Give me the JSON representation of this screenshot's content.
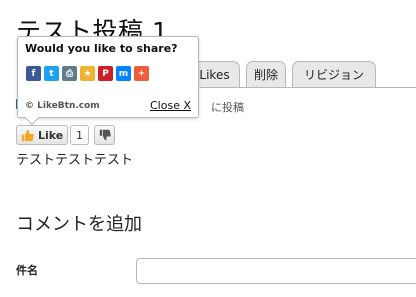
{
  "node": {
    "title": "テスト投稿",
    "title_suffix": "1",
    "meta_text": "に投稿",
    "body": "テストテストテスト"
  },
  "tabs": [
    {
      "label": "Likes"
    },
    {
      "label": "削除"
    },
    {
      "label": "リビジョン"
    }
  ],
  "share_popup": {
    "title": "Would you like to share?",
    "brand": "© LikeBtn.com",
    "close_label": "Close X",
    "icons": [
      {
        "name": "facebook-icon",
        "glyph": "f",
        "color": "#3b5998"
      },
      {
        "name": "twitter-icon",
        "glyph": "t",
        "color": "#1da1f2"
      },
      {
        "name": "print-icon",
        "glyph": "⎙",
        "color": "#607d8b"
      },
      {
        "name": "favorite-icon",
        "glyph": "★",
        "color": "#f2b231"
      },
      {
        "name": "pinterest-icon",
        "glyph": "P",
        "color": "#cb2027"
      },
      {
        "name": "messenger-icon",
        "glyph": "m",
        "color": "#0084ff"
      },
      {
        "name": "more-icon",
        "glyph": "+",
        "color": "#f05d3b"
      }
    ]
  },
  "like_widget": {
    "like_label": "Like",
    "like_count": "1",
    "thumb_color": "#f5a623"
  },
  "comments": {
    "section_title": "コメントを追加",
    "subject_label": "件名",
    "subject_value": ""
  }
}
